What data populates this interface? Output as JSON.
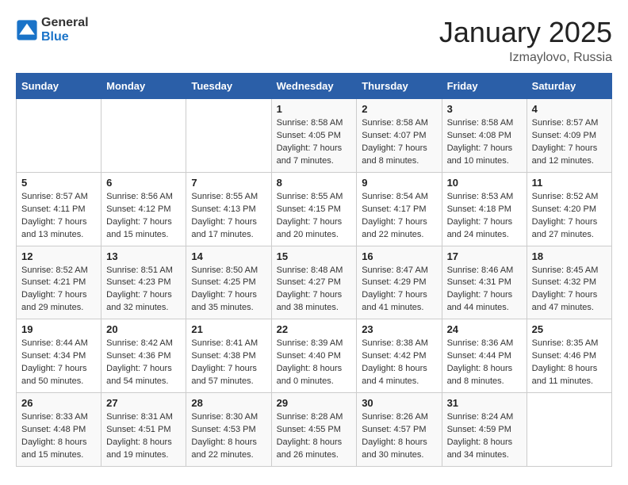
{
  "header": {
    "logo_general": "General",
    "logo_blue": "Blue",
    "month_title": "January 2025",
    "location": "Izmaylovo, Russia"
  },
  "weekdays": [
    "Sunday",
    "Monday",
    "Tuesday",
    "Wednesday",
    "Thursday",
    "Friday",
    "Saturday"
  ],
  "weeks": [
    [
      {
        "day": "",
        "info": ""
      },
      {
        "day": "",
        "info": ""
      },
      {
        "day": "",
        "info": ""
      },
      {
        "day": "1",
        "info": "Sunrise: 8:58 AM\nSunset: 4:05 PM\nDaylight: 7 hours\nand 7 minutes."
      },
      {
        "day": "2",
        "info": "Sunrise: 8:58 AM\nSunset: 4:07 PM\nDaylight: 7 hours\nand 8 minutes."
      },
      {
        "day": "3",
        "info": "Sunrise: 8:58 AM\nSunset: 4:08 PM\nDaylight: 7 hours\nand 10 minutes."
      },
      {
        "day": "4",
        "info": "Sunrise: 8:57 AM\nSunset: 4:09 PM\nDaylight: 7 hours\nand 12 minutes."
      }
    ],
    [
      {
        "day": "5",
        "info": "Sunrise: 8:57 AM\nSunset: 4:11 PM\nDaylight: 7 hours\nand 13 minutes."
      },
      {
        "day": "6",
        "info": "Sunrise: 8:56 AM\nSunset: 4:12 PM\nDaylight: 7 hours\nand 15 minutes."
      },
      {
        "day": "7",
        "info": "Sunrise: 8:55 AM\nSunset: 4:13 PM\nDaylight: 7 hours\nand 17 minutes."
      },
      {
        "day": "8",
        "info": "Sunrise: 8:55 AM\nSunset: 4:15 PM\nDaylight: 7 hours\nand 20 minutes."
      },
      {
        "day": "9",
        "info": "Sunrise: 8:54 AM\nSunset: 4:17 PM\nDaylight: 7 hours\nand 22 minutes."
      },
      {
        "day": "10",
        "info": "Sunrise: 8:53 AM\nSunset: 4:18 PM\nDaylight: 7 hours\nand 24 minutes."
      },
      {
        "day": "11",
        "info": "Sunrise: 8:52 AM\nSunset: 4:20 PM\nDaylight: 7 hours\nand 27 minutes."
      }
    ],
    [
      {
        "day": "12",
        "info": "Sunrise: 8:52 AM\nSunset: 4:21 PM\nDaylight: 7 hours\nand 29 minutes."
      },
      {
        "day": "13",
        "info": "Sunrise: 8:51 AM\nSunset: 4:23 PM\nDaylight: 7 hours\nand 32 minutes."
      },
      {
        "day": "14",
        "info": "Sunrise: 8:50 AM\nSunset: 4:25 PM\nDaylight: 7 hours\nand 35 minutes."
      },
      {
        "day": "15",
        "info": "Sunrise: 8:48 AM\nSunset: 4:27 PM\nDaylight: 7 hours\nand 38 minutes."
      },
      {
        "day": "16",
        "info": "Sunrise: 8:47 AM\nSunset: 4:29 PM\nDaylight: 7 hours\nand 41 minutes."
      },
      {
        "day": "17",
        "info": "Sunrise: 8:46 AM\nSunset: 4:31 PM\nDaylight: 7 hours\nand 44 minutes."
      },
      {
        "day": "18",
        "info": "Sunrise: 8:45 AM\nSunset: 4:32 PM\nDaylight: 7 hours\nand 47 minutes."
      }
    ],
    [
      {
        "day": "19",
        "info": "Sunrise: 8:44 AM\nSunset: 4:34 PM\nDaylight: 7 hours\nand 50 minutes."
      },
      {
        "day": "20",
        "info": "Sunrise: 8:42 AM\nSunset: 4:36 PM\nDaylight: 7 hours\nand 54 minutes."
      },
      {
        "day": "21",
        "info": "Sunrise: 8:41 AM\nSunset: 4:38 PM\nDaylight: 7 hours\nand 57 minutes."
      },
      {
        "day": "22",
        "info": "Sunrise: 8:39 AM\nSunset: 4:40 PM\nDaylight: 8 hours\nand 0 minutes."
      },
      {
        "day": "23",
        "info": "Sunrise: 8:38 AM\nSunset: 4:42 PM\nDaylight: 8 hours\nand 4 minutes."
      },
      {
        "day": "24",
        "info": "Sunrise: 8:36 AM\nSunset: 4:44 PM\nDaylight: 8 hours\nand 8 minutes."
      },
      {
        "day": "25",
        "info": "Sunrise: 8:35 AM\nSunset: 4:46 PM\nDaylight: 8 hours\nand 11 minutes."
      }
    ],
    [
      {
        "day": "26",
        "info": "Sunrise: 8:33 AM\nSunset: 4:48 PM\nDaylight: 8 hours\nand 15 minutes."
      },
      {
        "day": "27",
        "info": "Sunrise: 8:31 AM\nSunset: 4:51 PM\nDaylight: 8 hours\nand 19 minutes."
      },
      {
        "day": "28",
        "info": "Sunrise: 8:30 AM\nSunset: 4:53 PM\nDaylight: 8 hours\nand 22 minutes."
      },
      {
        "day": "29",
        "info": "Sunrise: 8:28 AM\nSunset: 4:55 PM\nDaylight: 8 hours\nand 26 minutes."
      },
      {
        "day": "30",
        "info": "Sunrise: 8:26 AM\nSunset: 4:57 PM\nDaylight: 8 hours\nand 30 minutes."
      },
      {
        "day": "31",
        "info": "Sunrise: 8:24 AM\nSunset: 4:59 PM\nDaylight: 8 hours\nand 34 minutes."
      },
      {
        "day": "",
        "info": ""
      }
    ]
  ]
}
